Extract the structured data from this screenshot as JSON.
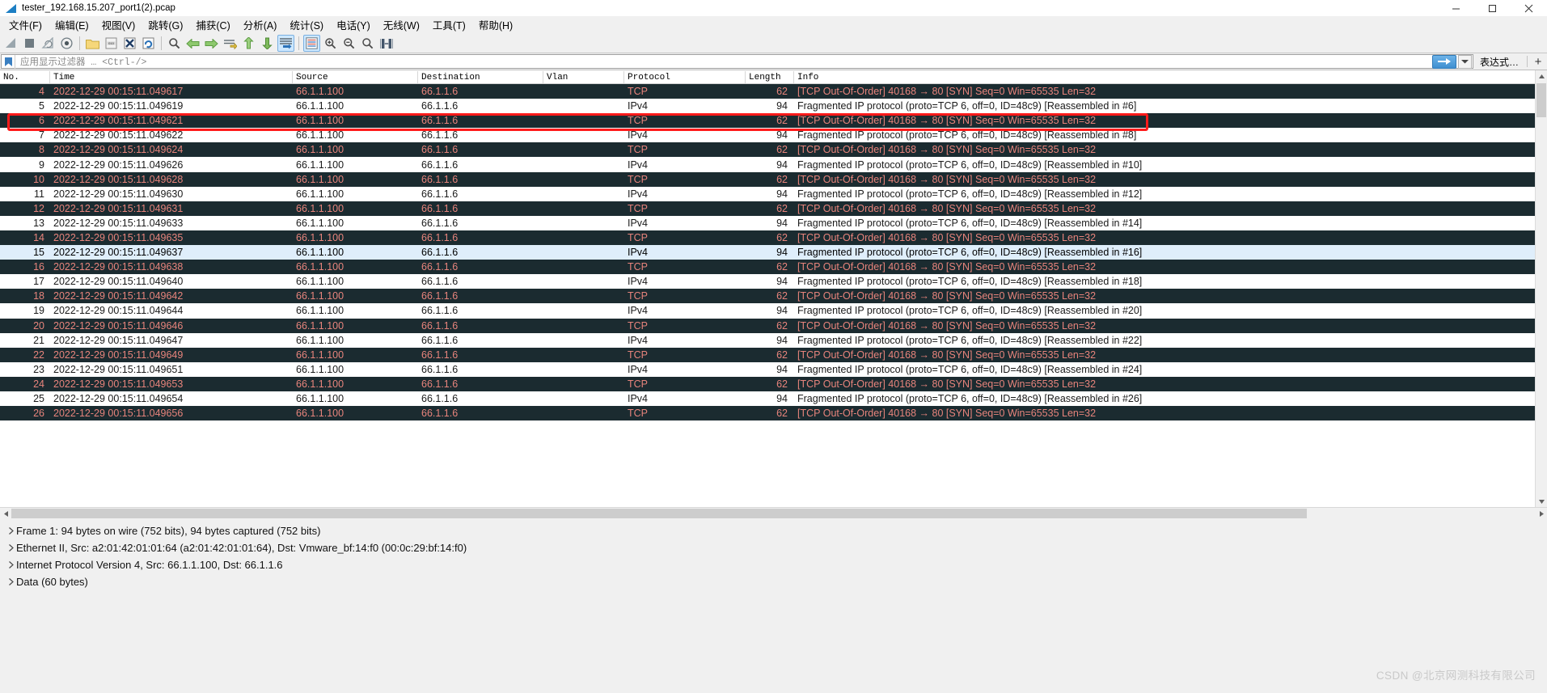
{
  "window": {
    "title": "tester_192.168.15.207_port1(2).pcap",
    "app_icon": "wireshark-fin-icon",
    "buttons": {
      "minimize": "–",
      "maximize": "□",
      "close": "✕"
    }
  },
  "menu": [
    {
      "label": "文件(F)",
      "name": "menu-file"
    },
    {
      "label": "编辑(E)",
      "name": "menu-edit"
    },
    {
      "label": "视图(V)",
      "name": "menu-view"
    },
    {
      "label": "跳转(G)",
      "name": "menu-go"
    },
    {
      "label": "捕获(C)",
      "name": "menu-capture"
    },
    {
      "label": "分析(A)",
      "name": "menu-analyze"
    },
    {
      "label": "统计(S)",
      "name": "menu-statistics"
    },
    {
      "label": "电话(Y)",
      "name": "menu-telephony"
    },
    {
      "label": "无线(W)",
      "name": "menu-wireless"
    },
    {
      "label": "工具(T)",
      "name": "menu-tools"
    },
    {
      "label": "帮助(H)",
      "name": "menu-help"
    }
  ],
  "toolbar": [
    {
      "name": "start-capture-icon",
      "glyph": "fin",
      "active": false
    },
    {
      "name": "stop-capture-icon",
      "glyph": "square",
      "active": false
    },
    {
      "name": "restart-capture-icon",
      "glyph": "restart",
      "active": false
    },
    {
      "name": "capture-options-icon",
      "glyph": "gear",
      "active": false
    },
    {
      "sep": true
    },
    {
      "name": "open-file-icon",
      "glyph": "folder",
      "active": false
    },
    {
      "name": "save-file-icon",
      "glyph": "save",
      "active": false
    },
    {
      "name": "close-file-icon",
      "glyph": "closex",
      "active": false
    },
    {
      "name": "reload-file-icon",
      "glyph": "reload",
      "active": false
    },
    {
      "sep": true
    },
    {
      "name": "find-packet-icon",
      "glyph": "magnify",
      "active": false
    },
    {
      "name": "go-back-icon",
      "glyph": "arrowleft",
      "active": false
    },
    {
      "name": "go-forward-icon",
      "glyph": "arrowright",
      "active": false
    },
    {
      "name": "go-to-packet-icon",
      "glyph": "goto",
      "active": false
    },
    {
      "name": "go-first-packet-icon",
      "glyph": "up",
      "active": false
    },
    {
      "name": "go-last-packet-icon",
      "glyph": "down",
      "active": false
    },
    {
      "name": "auto-scroll-icon",
      "glyph": "autoscroll",
      "active": true
    },
    {
      "sep": true
    },
    {
      "name": "colorize-packets-icon",
      "glyph": "colorize",
      "active": true
    },
    {
      "name": "zoom-in-icon",
      "glyph": "zoomin",
      "active": false
    },
    {
      "name": "zoom-out-icon",
      "glyph": "zoomout",
      "active": false
    },
    {
      "name": "zoom-reset-icon",
      "glyph": "zoomreset",
      "active": false
    },
    {
      "name": "resize-columns-icon",
      "glyph": "columns",
      "active": false
    }
  ],
  "filter": {
    "bookmark_icon": "bookmark-icon",
    "placeholder": "应用显示过滤器 … <Ctrl-/>",
    "value": "",
    "apply_icon": "apply-arrow-icon",
    "dropdown_icon": "chevron-down-icon",
    "expression_label": "表达式…",
    "add_label": "+"
  },
  "columns": [
    {
      "label": "No.",
      "name": "column-no"
    },
    {
      "label": "Time",
      "name": "column-time"
    },
    {
      "label": "Source",
      "name": "column-source"
    },
    {
      "label": "Destination",
      "name": "column-destination"
    },
    {
      "label": "Vlan",
      "name": "column-vlan"
    },
    {
      "label": "Protocol",
      "name": "column-protocol"
    },
    {
      "label": "Length",
      "name": "column-length"
    },
    {
      "label": "Info",
      "name": "column-info"
    }
  ],
  "packets": [
    {
      "no": "4",
      "time": "2022-12-29 00:15:11.049617",
      "src": "66.1.1.100",
      "dst": "66.1.1.6",
      "vlan": "",
      "proto": "TCP",
      "len": "62",
      "info": "[TCP Out-Of-Order] 40168 → 80 [SYN] Seq=0 Win=65535 Len=32",
      "style": "dark"
    },
    {
      "no": "5",
      "time": "2022-12-29 00:15:11.049619",
      "src": "66.1.1.100",
      "dst": "66.1.1.6",
      "vlan": "",
      "proto": "IPv4",
      "len": "94",
      "info": "Fragmented IP protocol (proto=TCP 6, off=0, ID=48c9) [Reassembled in #6]",
      "style": "light"
    },
    {
      "no": "6",
      "time": "2022-12-29 00:15:11.049621",
      "src": "66.1.1.100",
      "dst": "66.1.1.6",
      "vlan": "",
      "proto": "TCP",
      "len": "62",
      "info": "[TCP Out-Of-Order] 40168 → 80 [SYN] Seq=0 Win=65535 Len=32",
      "style": "dark"
    },
    {
      "no": "7",
      "time": "2022-12-29 00:15:11.049622",
      "src": "66.1.1.100",
      "dst": "66.1.1.6",
      "vlan": "",
      "proto": "IPv4",
      "len": "94",
      "info": "Fragmented IP protocol (proto=TCP 6, off=0, ID=48c9) [Reassembled in #8]",
      "style": "light"
    },
    {
      "no": "8",
      "time": "2022-12-29 00:15:11.049624",
      "src": "66.1.1.100",
      "dst": "66.1.1.6",
      "vlan": "",
      "proto": "TCP",
      "len": "62",
      "info": "[TCP Out-Of-Order] 40168 → 80 [SYN] Seq=0 Win=65535 Len=32",
      "style": "dark"
    },
    {
      "no": "9",
      "time": "2022-12-29 00:15:11.049626",
      "src": "66.1.1.100",
      "dst": "66.1.1.6",
      "vlan": "",
      "proto": "IPv4",
      "len": "94",
      "info": "Fragmented IP protocol (proto=TCP 6, off=0, ID=48c9) [Reassembled in #10]",
      "style": "light"
    },
    {
      "no": "10",
      "time": "2022-12-29 00:15:11.049628",
      "src": "66.1.1.100",
      "dst": "66.1.1.6",
      "vlan": "",
      "proto": "TCP",
      "len": "62",
      "info": "[TCP Out-Of-Order] 40168 → 80 [SYN] Seq=0 Win=65535 Len=32",
      "style": "dark"
    },
    {
      "no": "11",
      "time": "2022-12-29 00:15:11.049630",
      "src": "66.1.1.100",
      "dst": "66.1.1.6",
      "vlan": "",
      "proto": "IPv4",
      "len": "94",
      "info": "Fragmented IP protocol (proto=TCP 6, off=0, ID=48c9) [Reassembled in #12]",
      "style": "light"
    },
    {
      "no": "12",
      "time": "2022-12-29 00:15:11.049631",
      "src": "66.1.1.100",
      "dst": "66.1.1.6",
      "vlan": "",
      "proto": "TCP",
      "len": "62",
      "info": "[TCP Out-Of-Order] 40168 → 80 [SYN] Seq=0 Win=65535 Len=32",
      "style": "dark"
    },
    {
      "no": "13",
      "time": "2022-12-29 00:15:11.049633",
      "src": "66.1.1.100",
      "dst": "66.1.1.6",
      "vlan": "",
      "proto": "IPv4",
      "len": "94",
      "info": "Fragmented IP protocol (proto=TCP 6, off=0, ID=48c9) [Reassembled in #14]",
      "style": "light"
    },
    {
      "no": "14",
      "time": "2022-12-29 00:15:11.049635",
      "src": "66.1.1.100",
      "dst": "66.1.1.6",
      "vlan": "",
      "proto": "TCP",
      "len": "62",
      "info": "[TCP Out-Of-Order] 40168 → 80 [SYN] Seq=0 Win=65535 Len=32",
      "style": "dark"
    },
    {
      "no": "15",
      "time": "2022-12-29 00:15:11.049637",
      "src": "66.1.1.100",
      "dst": "66.1.1.6",
      "vlan": "",
      "proto": "IPv4",
      "len": "94",
      "info": "Fragmented IP protocol (proto=TCP 6, off=0, ID=48c9) [Reassembled in #16]",
      "style": "selected"
    },
    {
      "no": "16",
      "time": "2022-12-29 00:15:11.049638",
      "src": "66.1.1.100",
      "dst": "66.1.1.6",
      "vlan": "",
      "proto": "TCP",
      "len": "62",
      "info": "[TCP Out-Of-Order] 40168 → 80 [SYN] Seq=0 Win=65535 Len=32",
      "style": "dark"
    },
    {
      "no": "17",
      "time": "2022-12-29 00:15:11.049640",
      "src": "66.1.1.100",
      "dst": "66.1.1.6",
      "vlan": "",
      "proto": "IPv4",
      "len": "94",
      "info": "Fragmented IP protocol (proto=TCP 6, off=0, ID=48c9) [Reassembled in #18]",
      "style": "light"
    },
    {
      "no": "18",
      "time": "2022-12-29 00:15:11.049642",
      "src": "66.1.1.100",
      "dst": "66.1.1.6",
      "vlan": "",
      "proto": "TCP",
      "len": "62",
      "info": "[TCP Out-Of-Order] 40168 → 80 [SYN] Seq=0 Win=65535 Len=32",
      "style": "dark"
    },
    {
      "no": "19",
      "time": "2022-12-29 00:15:11.049644",
      "src": "66.1.1.100",
      "dst": "66.1.1.6",
      "vlan": "",
      "proto": "IPv4",
      "len": "94",
      "info": "Fragmented IP protocol (proto=TCP 6, off=0, ID=48c9) [Reassembled in #20]",
      "style": "light"
    },
    {
      "no": "20",
      "time": "2022-12-29 00:15:11.049646",
      "src": "66.1.1.100",
      "dst": "66.1.1.6",
      "vlan": "",
      "proto": "TCP",
      "len": "62",
      "info": "[TCP Out-Of-Order] 40168 → 80 [SYN] Seq=0 Win=65535 Len=32",
      "style": "dark"
    },
    {
      "no": "21",
      "time": "2022-12-29 00:15:11.049647",
      "src": "66.1.1.100",
      "dst": "66.1.1.6",
      "vlan": "",
      "proto": "IPv4",
      "len": "94",
      "info": "Fragmented IP protocol (proto=TCP 6, off=0, ID=48c9) [Reassembled in #22]",
      "style": "light"
    },
    {
      "no": "22",
      "time": "2022-12-29 00:15:11.049649",
      "src": "66.1.1.100",
      "dst": "66.1.1.6",
      "vlan": "",
      "proto": "TCP",
      "len": "62",
      "info": "[TCP Out-Of-Order] 40168 → 80 [SYN] Seq=0 Win=65535 Len=32",
      "style": "dark"
    },
    {
      "no": "23",
      "time": "2022-12-29 00:15:11.049651",
      "src": "66.1.1.100",
      "dst": "66.1.1.6",
      "vlan": "",
      "proto": "IPv4",
      "len": "94",
      "info": "Fragmented IP protocol (proto=TCP 6, off=0, ID=48c9) [Reassembled in #24]",
      "style": "light"
    },
    {
      "no": "24",
      "time": "2022-12-29 00:15:11.049653",
      "src": "66.1.1.100",
      "dst": "66.1.1.6",
      "vlan": "",
      "proto": "TCP",
      "len": "62",
      "info": "[TCP Out-Of-Order] 40168 → 80 [SYN] Seq=0 Win=65535 Len=32",
      "style": "dark"
    },
    {
      "no": "25",
      "time": "2022-12-29 00:15:11.049654",
      "src": "66.1.1.100",
      "dst": "66.1.1.6",
      "vlan": "",
      "proto": "IPv4",
      "len": "94",
      "info": "Fragmented IP protocol (proto=TCP 6, off=0, ID=48c9) [Reassembled in #26]",
      "style": "light"
    },
    {
      "no": "26",
      "time": "2022-12-29 00:15:11.049656",
      "src": "66.1.1.100",
      "dst": "66.1.1.6",
      "vlan": "",
      "proto": "TCP",
      "len": "62",
      "info": "[TCP Out-Of-Order] 40168 → 80 [SYN] Seq=0 Win=65535 Len=32",
      "style": "dark"
    }
  ],
  "annotation": {
    "type": "red-highlight-rectangle",
    "color": "#ff1a1a",
    "targets_packet_no": "7"
  },
  "detail_tree": [
    {
      "label": "Frame 1: 94 bytes on wire (752 bits), 94 bytes captured (752 bits)",
      "name": "detail-frame"
    },
    {
      "label": "Ethernet II, Src: a2:01:42:01:01:64 (a2:01:42:01:01:64), Dst: Vmware_bf:14:f0 (00:0c:29:bf:14:f0)",
      "name": "detail-ethernet"
    },
    {
      "label": "Internet Protocol Version 4, Src: 66.1.1.100, Dst: 66.1.1.6",
      "name": "detail-ipv4"
    },
    {
      "label": "Data (60 bytes)",
      "name": "detail-data"
    }
  ],
  "watermark": "CSDN @北京网测科技有限公司"
}
